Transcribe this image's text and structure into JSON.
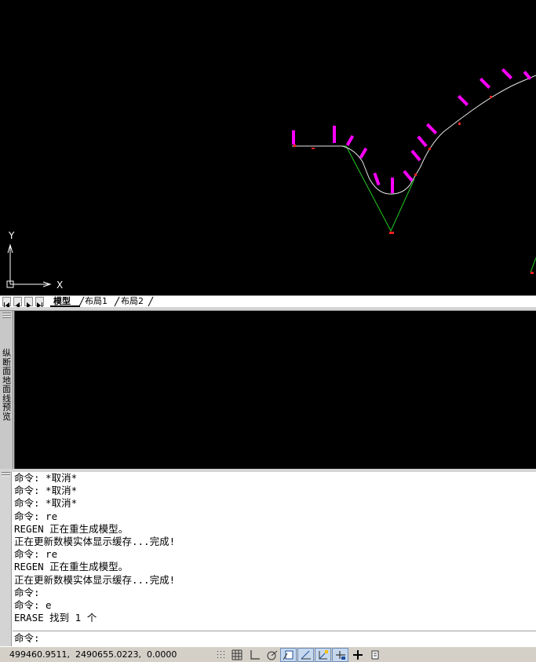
{
  "layout_tabs": [
    "模型",
    "布局1",
    "布局2"
  ],
  "palette": {
    "title": "纵断面地面线预览"
  },
  "ucs": {
    "x_label": "X",
    "y_label": "Y"
  },
  "command": {
    "history": [
      "命令: *取消*",
      "命令: *取消*",
      "命令: *取消*",
      "命令: re",
      "REGEN 正在重生成模型。",
      "正在更新数模实体显示缓存...完成!",
      "命令: re",
      "REGEN 正在重生成模型。",
      "正在更新数模实体显示缓存...完成!",
      "命令:",
      "命令: e",
      "ERASE 找到 1 个"
    ],
    "prompt": "命令:"
  },
  "status": {
    "coordinates": "499460.9511,  2490655.0223,  0.0000"
  },
  "status_toggles": [
    {
      "name": "snap-toggle",
      "icon": "snap-icon",
      "on": false
    },
    {
      "name": "grid-toggle",
      "icon": "grid-icon",
      "on": false
    },
    {
      "name": "ortho-toggle",
      "icon": "ortho-icon",
      "on": false
    },
    {
      "name": "polar-toggle",
      "icon": "polar-icon",
      "on": false
    },
    {
      "name": "osnap-toggle",
      "icon": "osnap-icon",
      "on": true
    },
    {
      "name": "otrack-toggle",
      "icon": "otrack-icon",
      "on": true
    },
    {
      "name": "ducs-toggle",
      "icon": "ducs-icon",
      "on": true
    },
    {
      "name": "dyn-toggle",
      "icon": "dyn-icon",
      "on": true
    },
    {
      "name": "lineweight-toggle",
      "icon": "lineweight-icon",
      "on": false
    },
    {
      "name": "qp-toggle",
      "icon": "quick-properties-icon",
      "on": false
    }
  ],
  "colors": {
    "alignment": "#dcdcdc",
    "tangent": "#22cc22",
    "station_label": "#ff00ff",
    "marker": "#ff2020"
  }
}
